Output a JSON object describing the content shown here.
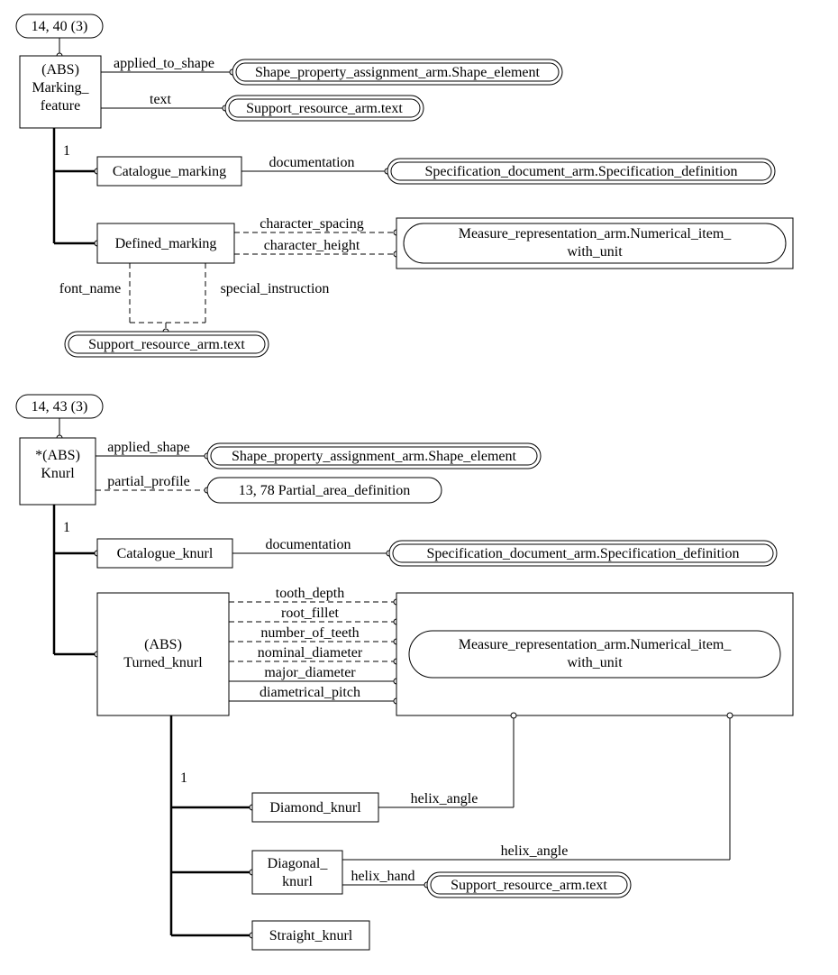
{
  "diagram1": {
    "page_ref": "14, 40 (3)",
    "root": {
      "stereotype": "(ABS)",
      "name1": "Marking_",
      "name2": "feature"
    },
    "attributes": {
      "applied_to_shape": {
        "label": "applied_to_shape",
        "target": "Shape_property_assignment_arm.Shape_element"
      },
      "text": {
        "label": "text",
        "target": "Support_resource_arm.text"
      }
    },
    "subtype_card": "1",
    "subtypes": {
      "catalogue_marking": {
        "name": "Catalogue_marking",
        "attrs": {
          "documentation": {
            "label": "documentation",
            "target": "Specification_document_arm.Specification_definition"
          }
        }
      },
      "defined_marking": {
        "name": "Defined_marking",
        "attrs": {
          "character_spacing": {
            "label": "character_spacing"
          },
          "character_height": {
            "label": "character_height"
          },
          "target": {
            "line1": "Measure_representation_arm.Numerical_item_",
            "line2": "with_unit"
          },
          "font_name": {
            "label": "font_name"
          },
          "special_instruction": {
            "label": "special_instruction"
          },
          "text_target": "Support_resource_arm.text"
        }
      }
    }
  },
  "diagram2": {
    "page_ref": "14, 43 (3)",
    "root": {
      "stereotype": "*(ABS)",
      "name": "Knurl"
    },
    "attributes": {
      "applied_shape": {
        "label": "applied_shape",
        "target": "Shape_property_assignment_arm.Shape_element"
      },
      "partial_profile": {
        "label": "partial_profile",
        "target": "13, 78 Partial_area_definition"
      }
    },
    "subtype_card": "1",
    "subtypes": {
      "catalogue_knurl": {
        "name": "Catalogue_knurl",
        "attrs": {
          "documentation": {
            "label": "documentation",
            "target": "Specification_document_arm.Specification_definition"
          }
        }
      },
      "turned_knurl": {
        "stereotype": "(ABS)",
        "name": "Turned_knurl",
        "attrs": {
          "tooth_depth": "tooth_depth",
          "root_fillet": "root_fillet",
          "number_of_teeth": "number_of_teeth",
          "nominal_diameter": "nominal_diameter",
          "major_diameter": "major_diameter",
          "diametrical_pitch": "diametrical_pitch",
          "target": {
            "line1": "Measure_representation_arm.Numerical_item_",
            "line2": "with_unit"
          }
        },
        "subtype_card": "1",
        "subtypes": {
          "diamond_knurl": {
            "name": "Diamond_knurl",
            "helix_angle": "helix_angle"
          },
          "diagonal_knurl": {
            "name1": "Diagonal_",
            "name2": "knurl",
            "helix_angle": "helix_angle",
            "helix_hand": "helix_hand",
            "hand_target": "Support_resource_arm.text"
          },
          "straight_knurl": {
            "name": "Straight_knurl"
          }
        }
      }
    }
  }
}
